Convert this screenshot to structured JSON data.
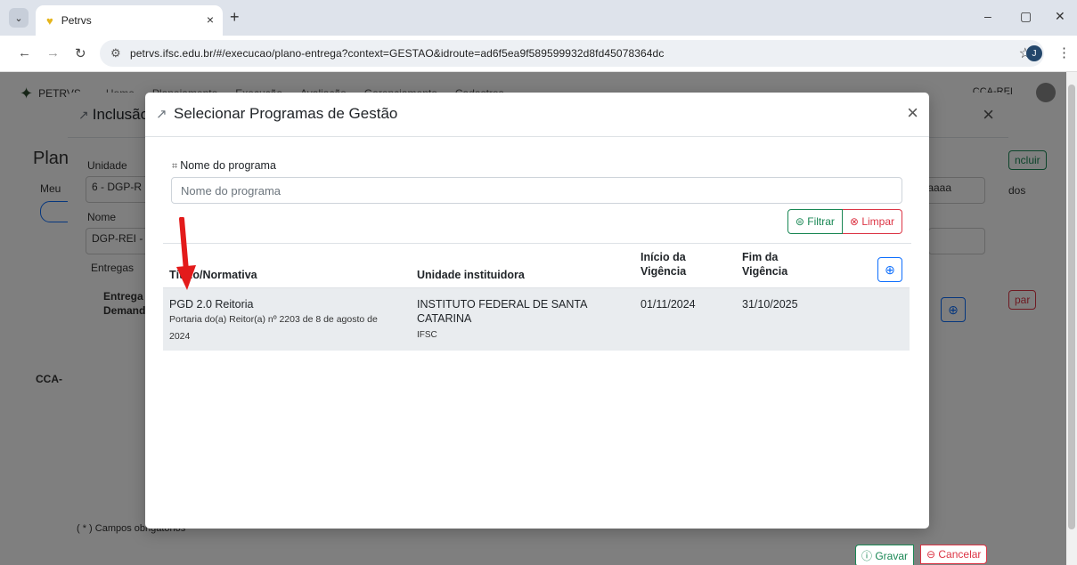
{
  "browser": {
    "tab_title": "Petrvs",
    "tab_close": "×",
    "new_tab": "+",
    "url": "petrvs.ifsc.edu.br/#/execucao/plano-entrega?context=GESTAO&idroute=ad6f5ea9f589599932d8fd45078364dc",
    "profile_initial": "J",
    "win_minimize": "–",
    "win_restore": "▢",
    "win_close": "✕"
  },
  "app": {
    "brand": "PETRVS",
    "nav": [
      "Home",
      "Planejamento",
      "Execução",
      "Avaliação",
      "Gerenciamento",
      "Cadastros"
    ],
    "user": "CCA-REI"
  },
  "background": {
    "page_title": "Plan",
    "meus": "Meu",
    "unidade_label": "Unidade",
    "unidade_value": "6 - DGP-R",
    "nome_label": "Nome",
    "nome_value": "DGP-REI -",
    "entregas_label": "Entregas",
    "entregas_col": "Entrega",
    "demanda_col": "Demand",
    "incluir": "ncluir",
    "date_placeholder": "/aaaa",
    "todos": "dos",
    "limpar": "par",
    "cca": "CCA-",
    "campos_obrigatorios": "( * ) Campos obrigatórios",
    "gravar": "Gravar",
    "cancelar": "Cancelar"
  },
  "modal_inclusao": {
    "title": "Inclusão"
  },
  "modal": {
    "title": "Selecionar Programas de Gestão",
    "close": "×",
    "field_label": "Nome do programa",
    "field_placeholder": "Nome do programa",
    "filtrar": "Filtrar",
    "limpar": "Limpar",
    "add_symbol": "⊕",
    "columns": {
      "titulo": "Título/Normativa",
      "unidade": "Unidade instituidora",
      "inicio": "Início da Vigência",
      "fim": "Fim da Vigência"
    },
    "rows": [
      {
        "titulo": "PGD 2.0 Reitoria",
        "normativa": "Portaria do(a) Reitor(a) nº 2203 de 8 de agosto de 2024",
        "unidade": "INSTITUTO FEDERAL DE SANTA CATARINA",
        "unidade_sigla": "IFSC",
        "inicio": "01/11/2024",
        "fim": "31/10/2025"
      }
    ]
  },
  "colors": {
    "success": "#198754",
    "danger": "#dc3545",
    "primary": "#0d6efd",
    "arrow": "#e31b1b"
  }
}
